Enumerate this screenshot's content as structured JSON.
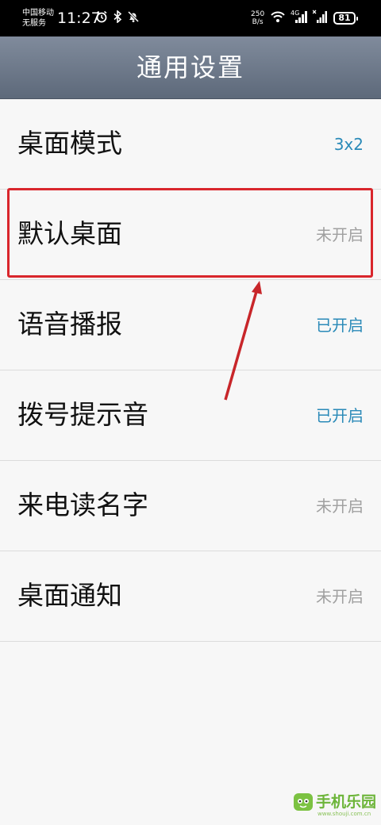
{
  "status_bar": {
    "carrier_line1": "中国移动",
    "carrier_line2": "无服务",
    "time": "11:27",
    "speed_value": "250",
    "speed_unit": "B/s",
    "network": "4G",
    "battery": "81",
    "icons": [
      "alarm-icon",
      "bluetooth-icon",
      "mute-icon",
      "wifi-icon",
      "signal-icon",
      "signal-x-icon",
      "battery-icon"
    ]
  },
  "header": {
    "title": "通用设置"
  },
  "settings": [
    {
      "label": "桌面模式",
      "value": "3x2",
      "state": "on"
    },
    {
      "label": "默认桌面",
      "value": "未开启",
      "state": "off"
    },
    {
      "label": "语音播报",
      "value": "已开启",
      "state": "on"
    },
    {
      "label": "拨号提示音",
      "value": "已开启",
      "state": "on"
    },
    {
      "label": "来电读名字",
      "value": "未开启",
      "state": "off"
    },
    {
      "label": "桌面通知",
      "value": "未开启",
      "state": "off"
    }
  ],
  "colors": {
    "accent_on": "#2a8ab8",
    "value_off": "#a0a0a0",
    "highlight": "#d9262c",
    "header": "#6b7687"
  },
  "watermark": {
    "text": "手机乐园",
    "sub": "www.shouji.com.cn"
  }
}
